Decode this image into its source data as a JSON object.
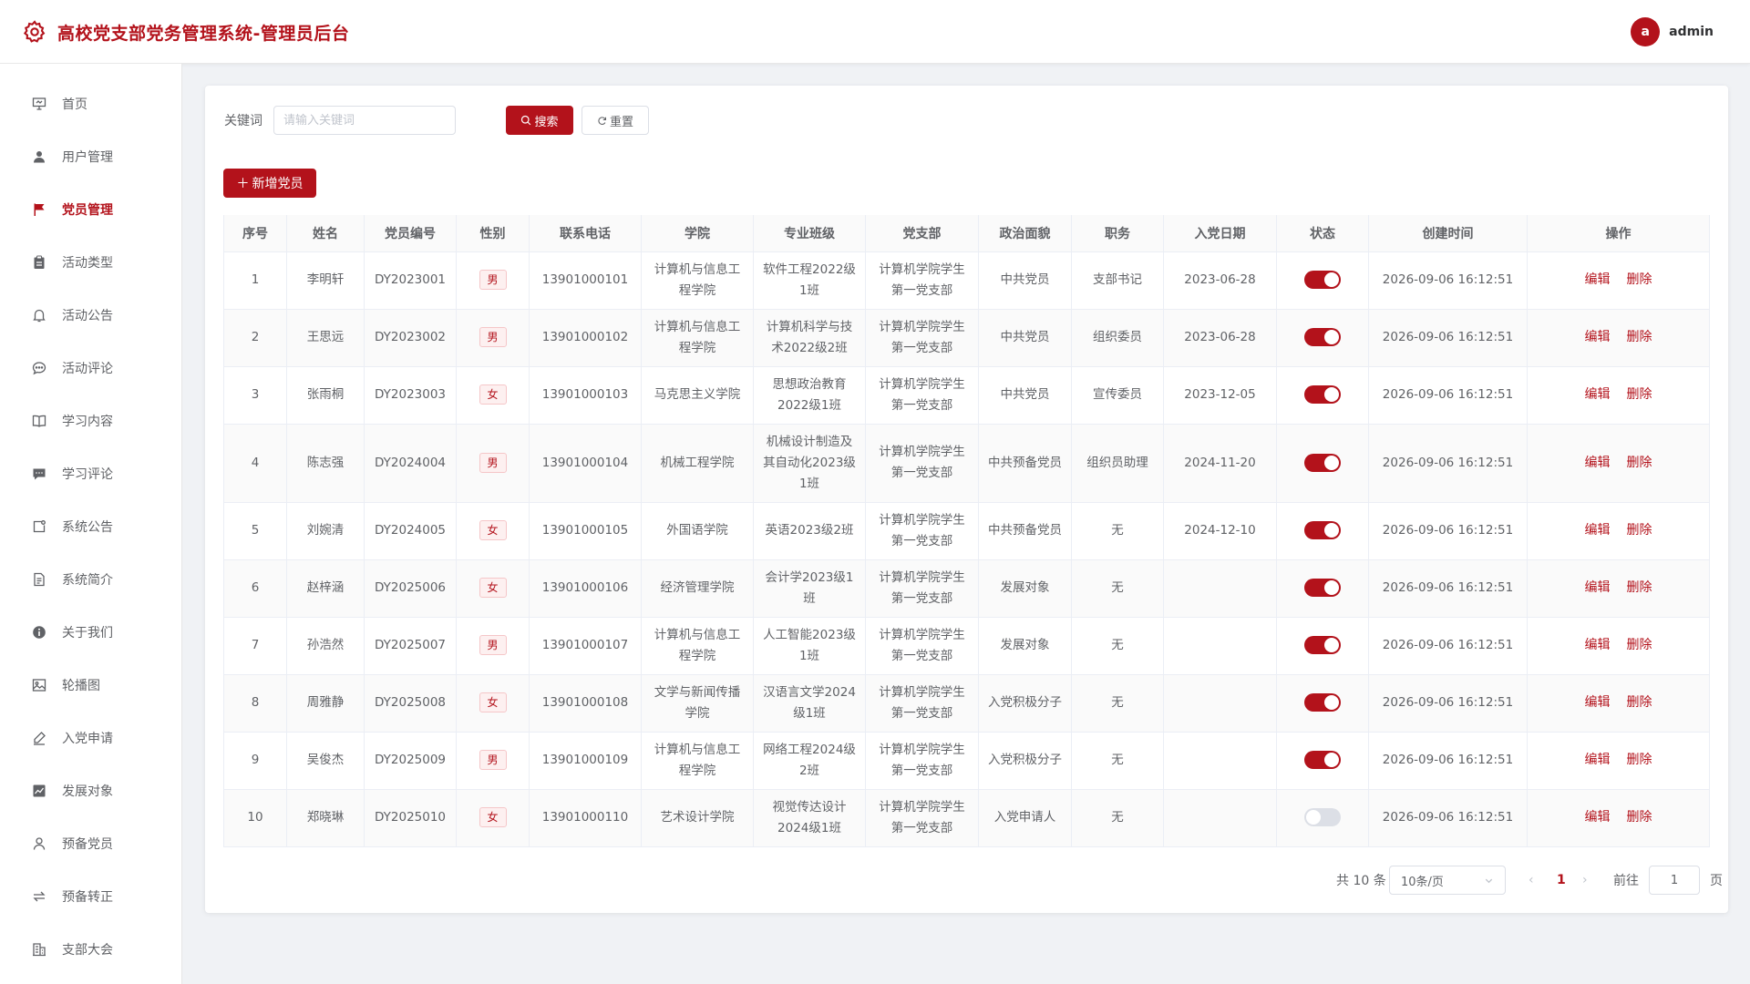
{
  "header": {
    "title": "高校党支部党务管理系统-管理员后台",
    "user_initial": "a",
    "user_name": "admin"
  },
  "colors": {
    "brand": "#b3121b"
  },
  "sidebar": {
    "items": [
      {
        "label": "首页",
        "icon": "presentation-icon",
        "active": false
      },
      {
        "label": "用户管理",
        "icon": "user-icon",
        "active": false
      },
      {
        "label": "党员管理",
        "icon": "flag-icon",
        "active": true
      },
      {
        "label": "活动类型",
        "icon": "clipboard-icon",
        "active": false
      },
      {
        "label": "活动公告",
        "icon": "bell-icon",
        "active": false
      },
      {
        "label": "活动评论",
        "icon": "chat-bubble-icon",
        "active": false
      },
      {
        "label": "学习内容",
        "icon": "book-icon",
        "active": false
      },
      {
        "label": "学习评论",
        "icon": "chat-filled-icon",
        "active": false
      },
      {
        "label": "系统公告",
        "icon": "notice-icon",
        "active": false
      },
      {
        "label": "系统简介",
        "icon": "document-icon",
        "active": false
      },
      {
        "label": "关于我们",
        "icon": "info-icon",
        "active": false
      },
      {
        "label": "轮播图",
        "icon": "picture-icon",
        "active": false
      },
      {
        "label": "入党申请",
        "icon": "edit-pen-icon",
        "active": false
      },
      {
        "label": "发展对象",
        "icon": "chart-icon",
        "active": false
      },
      {
        "label": "预备党员",
        "icon": "user-outline-icon",
        "active": false
      },
      {
        "label": "预备转正",
        "icon": "switch-icon",
        "active": false
      },
      {
        "label": "支部大会",
        "icon": "office-building-icon",
        "active": false
      }
    ]
  },
  "search": {
    "label": "关键词",
    "placeholder": "请输入关键词",
    "search_label": "搜索",
    "reset_label": "重置"
  },
  "toolbar": {
    "add_label": "新增党员"
  },
  "table": {
    "columns": [
      "序号",
      "姓名",
      "党员编号",
      "性别",
      "联系电话",
      "学院",
      "专业班级",
      "党支部",
      "政治面貌",
      "职务",
      "入党日期",
      "状态",
      "创建时间",
      "操作"
    ],
    "edit_label": "编辑",
    "delete_label": "删除",
    "rows": [
      {
        "no": "1",
        "name": "李明轩",
        "code": "DY2023001",
        "gender": "男",
        "phone": "13901000101",
        "college": "计算机与信息工程学院",
        "major": "软件工程2022级1班",
        "branch": "计算机学院学生第一党支部",
        "political": "中共党员",
        "position": "支部书记",
        "join_date": "2023-06-28",
        "status": true,
        "created": "2026-09-06 16:12:51"
      },
      {
        "no": "2",
        "name": "王思远",
        "code": "DY2023002",
        "gender": "男",
        "phone": "13901000102",
        "college": "计算机与信息工程学院",
        "major": "计算机科学与技术2022级2班",
        "branch": "计算机学院学生第一党支部",
        "political": "中共党员",
        "position": "组织委员",
        "join_date": "2023-06-28",
        "status": true,
        "created": "2026-09-06 16:12:51"
      },
      {
        "no": "3",
        "name": "张雨桐",
        "code": "DY2023003",
        "gender": "女",
        "phone": "13901000103",
        "college": "马克思主义学院",
        "major": "思想政治教育2022级1班",
        "branch": "计算机学院学生第一党支部",
        "political": "中共党员",
        "position": "宣传委员",
        "join_date": "2023-12-05",
        "status": true,
        "created": "2026-09-06 16:12:51"
      },
      {
        "no": "4",
        "name": "陈志强",
        "code": "DY2024004",
        "gender": "男",
        "phone": "13901000104",
        "college": "机械工程学院",
        "major": "机械设计制造及其自动化2023级1班",
        "branch": "计算机学院学生第一党支部",
        "political": "中共预备党员",
        "position": "组织员助理",
        "join_date": "2024-11-20",
        "status": true,
        "created": "2026-09-06 16:12:51"
      },
      {
        "no": "5",
        "name": "刘婉清",
        "code": "DY2024005",
        "gender": "女",
        "phone": "13901000105",
        "college": "外国语学院",
        "major": "英语2023级2班",
        "branch": "计算机学院学生第一党支部",
        "political": "中共预备党员",
        "position": "无",
        "join_date": "2024-12-10",
        "status": true,
        "created": "2026-09-06 16:12:51"
      },
      {
        "no": "6",
        "name": "赵梓涵",
        "code": "DY2025006",
        "gender": "女",
        "phone": "13901000106",
        "college": "经济管理学院",
        "major": "会计学2023级1班",
        "branch": "计算机学院学生第一党支部",
        "political": "发展对象",
        "position": "无",
        "join_date": "",
        "status": true,
        "created": "2026-09-06 16:12:51"
      },
      {
        "no": "7",
        "name": "孙浩然",
        "code": "DY2025007",
        "gender": "男",
        "phone": "13901000107",
        "college": "计算机与信息工程学院",
        "major": "人工智能2023级1班",
        "branch": "计算机学院学生第一党支部",
        "political": "发展对象",
        "position": "无",
        "join_date": "",
        "status": true,
        "created": "2026-09-06 16:12:51"
      },
      {
        "no": "8",
        "name": "周雅静",
        "code": "DY2025008",
        "gender": "女",
        "phone": "13901000108",
        "college": "文学与新闻传播学院",
        "major": "汉语言文学2024级1班",
        "branch": "计算机学院学生第一党支部",
        "political": "入党积极分子",
        "position": "无",
        "join_date": "",
        "status": true,
        "created": "2026-09-06 16:12:51"
      },
      {
        "no": "9",
        "name": "吴俊杰",
        "code": "DY2025009",
        "gender": "男",
        "phone": "13901000109",
        "college": "计算机与信息工程学院",
        "major": "网络工程2024级2班",
        "branch": "计算机学院学生第一党支部",
        "political": "入党积极分子",
        "position": "无",
        "join_date": "",
        "status": true,
        "created": "2026-09-06 16:12:51"
      },
      {
        "no": "10",
        "name": "郑晓琳",
        "code": "DY2025010",
        "gender": "女",
        "phone": "13901000110",
        "college": "艺术设计学院",
        "major": "视觉传达设计2024级1班",
        "branch": "计算机学院学生第一党支部",
        "political": "入党申请人",
        "position": "无",
        "join_date": "",
        "status": false,
        "created": "2026-09-06 16:12:51"
      }
    ]
  },
  "pagination": {
    "total_text": "共 10 条",
    "page_size": "10条/页",
    "current_page": "1",
    "goto_label": "前往",
    "goto_value": "1",
    "page_unit": "页"
  }
}
